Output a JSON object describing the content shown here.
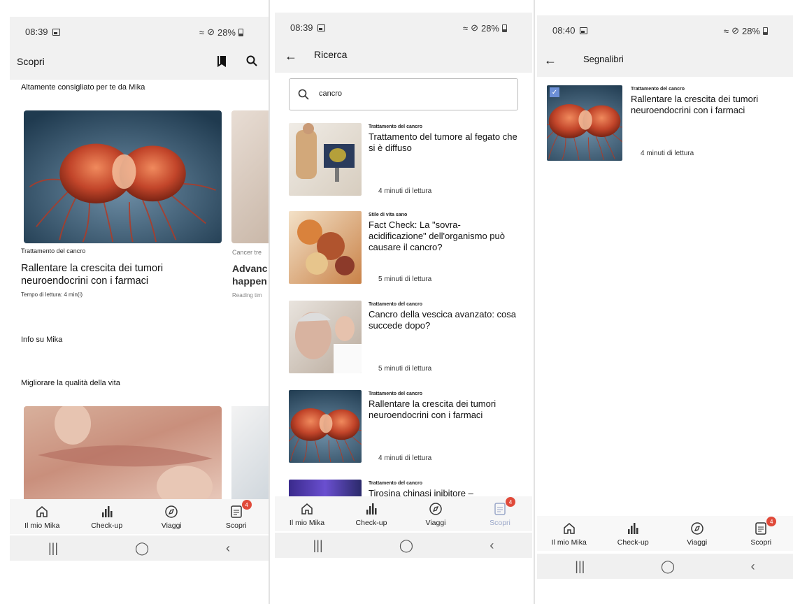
{
  "colors": {
    "accent_inactive": "#9aa7c9",
    "badge": "#e04a3a",
    "band": "#f1f1f1"
  },
  "common": {
    "battery": "28%",
    "nav": [
      {
        "label": "Il mio Mika",
        "icon": "home-icon"
      },
      {
        "label": "Check-up",
        "icon": "bar-chart-icon"
      },
      {
        "label": "Viaggi",
        "icon": "compass-icon"
      },
      {
        "label": "Scopri",
        "icon": "document-icon",
        "badge": "4"
      }
    ]
  },
  "screen1": {
    "time": "08:39",
    "title": "Scopri",
    "section_recommended": "Altamente consigliato per te da Mika",
    "card": {
      "category": "Trattamento del cancro",
      "title": "Rallentare la crescita dei tumori neuroendocrini con i farmaci",
      "reading": "Tempo di lettura: 4 min(i)"
    },
    "peek_card": {
      "category": "Cancer tre",
      "title_line1": "Advanc",
      "title_line2": "happen",
      "reading": "Reading tim"
    },
    "section_info": "Info su Mika",
    "section_quality": "Migliorare la qualità della vita"
  },
  "screen2": {
    "time": "08:39",
    "title": "Ricerca",
    "search_value": "cancro",
    "results": [
      {
        "category": "Trattamento del cancro",
        "title": "Trattamento del tumore al fegato che si è diffuso",
        "reading": "4 minuti di lettura",
        "image": "doctor-screen"
      },
      {
        "category": "Stile di vita sano",
        "title": "Fact Check: La \"sovra-acidificazione\" dell'organismo può causare il cancro?",
        "reading": "5 minuti di lettura",
        "image": "food"
      },
      {
        "category": "Trattamento del cancro",
        "title": "Cancro della vescica avanzato: cosa succede dopo?",
        "reading": "5 minuti di lettura",
        "image": "patient"
      },
      {
        "category": "Trattamento del cancro",
        "title": "Rallentare la crescita dei tumori neuroendocrini con i farmaci",
        "reading": "4 minuti di lettura",
        "image": "cell"
      },
      {
        "category": "Trattamento del cancro",
        "title": "Tirosina chinasi inibitore –",
        "reading": "",
        "image": "purple"
      }
    ]
  },
  "screen3": {
    "time": "08:40",
    "title": "Segnalibri",
    "bookmark": {
      "category": "Trattamento del cancro",
      "title": "Rallentare la crescita dei tumori neuroendocrini con i farmaci",
      "reading": "4 minuti di lettura"
    }
  }
}
